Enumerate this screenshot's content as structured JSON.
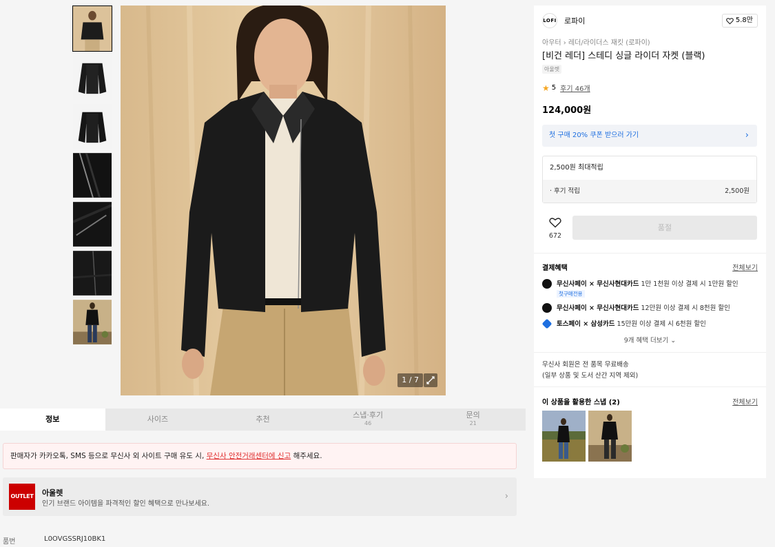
{
  "gallery": {
    "counter": "1 / 7",
    "thumbnails": [
      "thumb-1",
      "thumb-2",
      "thumb-3",
      "thumb-4",
      "thumb-5",
      "thumb-6",
      "thumb-7"
    ]
  },
  "tabs": [
    {
      "label": "정보",
      "count": ""
    },
    {
      "label": "사이즈",
      "count": ""
    },
    {
      "label": "추천",
      "count": ""
    },
    {
      "label": "스냅·후기",
      "count": "46"
    },
    {
      "label": "문의",
      "count": "21"
    }
  ],
  "warning": {
    "text_before": "판매자가 카카오톡, SMS 등으로 무신사 외 사이트 구매 유도 시, ",
    "link": "무신사 안전거래센터에 신고",
    "text_after": " 해주세요."
  },
  "outlet": {
    "logo": "OUTLET",
    "title": "아울렛",
    "desc": "인기 브랜드 아이템을 파격적인 할인 혜택으로 만나보세요."
  },
  "product_number": {
    "label": "품번",
    "value": "L0OVGSSRJ10BK1"
  },
  "brand": {
    "logo": "LOFI",
    "name": "로파이",
    "likes": "5.8만"
  },
  "breadcrumb": {
    "category": "아우터",
    "sub": "레더/라이더스 재킷 (로파이)"
  },
  "product": {
    "title": "[비건 레더] 스테디 싱글 라이더 자켓 (블랙)",
    "tag": "아울렛",
    "rating": "5",
    "reviews": "후기 46개",
    "price": "124,000원"
  },
  "coupon": {
    "text": "첫 구매 20% 쿠폰 받으러 가기"
  },
  "points": {
    "max": "2,500원 최대적립",
    "review_label": "· 후기 적립",
    "review_value": "2,500원"
  },
  "buy": {
    "heart_count": "672",
    "soldout": "품절"
  },
  "payment": {
    "title": "결제혜택",
    "see_all": "전체보기",
    "items": [
      {
        "brand": "무신사페이 × 무신사현대카드",
        "text": " 1만 1천원 이상 결제 시 1만원 할인",
        "tag": "첫구매전용"
      },
      {
        "brand": "무신사페이 × 무신사현대카드",
        "text": " 12만원 이상 결제 시 8천원 할인",
        "tag": ""
      },
      {
        "brand": "토스페이 × 삼성카드",
        "text": " 15만원 이상 결제 시 6천원 할인",
        "tag": ""
      }
    ],
    "more": "9개 혜택 더보기"
  },
  "shipping": {
    "line1": "무신사 회원은 전 품목 무료배송",
    "line2": "(일부 상품 및 도서 산간 지역 제외)"
  },
  "snap": {
    "title": "이 상품을 활용한 스냅 (2)",
    "see_all": "전체보기"
  },
  "colors": {
    "accent_blue": "#1e6fe0",
    "warning_red": "#e03030",
    "outlet_red": "#cc0000",
    "star": "#f5a623"
  }
}
